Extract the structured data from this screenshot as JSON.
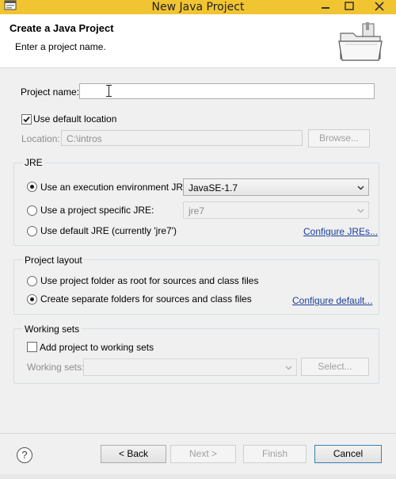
{
  "window": {
    "title": "New Java Project",
    "minimize_icon": "minimize-icon",
    "maximize_icon": "maximize-icon",
    "close_icon": "close-icon",
    "app_icon": "eclipse-app-icon"
  },
  "header": {
    "title": "Create a Java Project",
    "message": "Enter a project name.",
    "image": "folder-wizard-icon"
  },
  "project": {
    "name_label": "Project name:",
    "name_value": "",
    "use_default_label": "Use default location",
    "use_default_checked": true,
    "location_label": "Location:",
    "location_value": "C:\\intros",
    "browse_label": "Browse..."
  },
  "jre": {
    "group_title": "JRE",
    "options": [
      {
        "label": "Use an execution environment JRE:",
        "selected": true
      },
      {
        "label": "Use a project specific JRE:",
        "selected": false
      },
      {
        "label": "Use default JRE (currently 'jre7')",
        "selected": false
      }
    ],
    "execution_env_value": "JavaSE-1.7",
    "project_jre_value": "jre7",
    "configure_link": "Configure JREs..."
  },
  "layout": {
    "group_title": "Project layout",
    "options": [
      {
        "label": "Use project folder as root for sources and class files",
        "selected": false
      },
      {
        "label": "Create separate folders for sources and class files",
        "selected": true
      }
    ],
    "configure_link": "Configure default..."
  },
  "working_sets": {
    "group_title": "Working sets",
    "add_label": "Add project to working sets",
    "add_checked": false,
    "sets_label": "Working sets:",
    "sets_value": "",
    "select_label": "Select..."
  },
  "footer": {
    "help_icon": "help-icon",
    "help_glyph": "?",
    "back_label": "< Back",
    "next_label": "Next >",
    "finish_label": "Finish",
    "cancel_label": "Cancel"
  }
}
